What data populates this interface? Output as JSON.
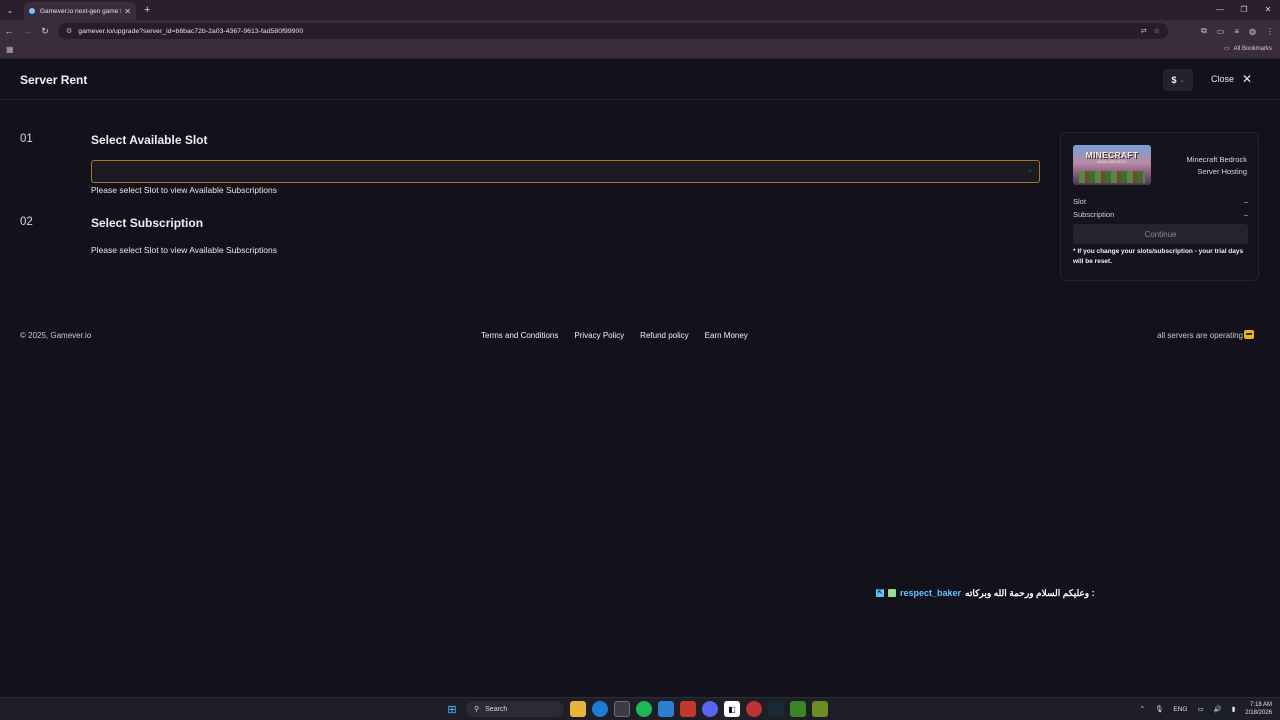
{
  "browser": {
    "tab_title": "Gamever.io next-gen game ho",
    "url": "gamever.io/upgrade?server_id=b6bac72b-2a03-4367-9613-fad580f99900",
    "bookmarks_label": "All Bookmarks"
  },
  "page": {
    "title": "Server Rent",
    "currency": "$",
    "close_label": "Close"
  },
  "steps": [
    {
      "number": "01",
      "title": "Select Available Slot",
      "hint": "Please select Slot to view Available Subscriptions"
    },
    {
      "number": "02",
      "title": "Select Subscription",
      "hint": "Please select Slot to view Available Subscriptions"
    }
  ],
  "summary": {
    "image_logo": "MINECRAFT",
    "image_sub": "JAVA & BEDROCK",
    "game_name_line1": "Minecraft Bedrock",
    "game_name_line2": "Server Hosting",
    "slot_label": "Slot",
    "slot_value": "–",
    "subscription_label": "Subscription",
    "subscription_value": "–",
    "continue_label": "Continue",
    "note": "* If you change your slots/subscription - your trial days will be reset."
  },
  "footer": {
    "copyright": "© 2025, Gamever.io",
    "links": [
      "Terms and Conditions",
      "Privacy Policy",
      "Refund policy",
      "Earn Money"
    ],
    "status": "all servers are operating"
  },
  "chat_overlay": {
    "username": "respect_baker",
    "message": ": وعليكم السلام ورحمة الله وبركاته"
  },
  "taskbar": {
    "search_label": "Search",
    "language": "ENG",
    "time": "7:18 AM",
    "date": "2/18/2026"
  }
}
